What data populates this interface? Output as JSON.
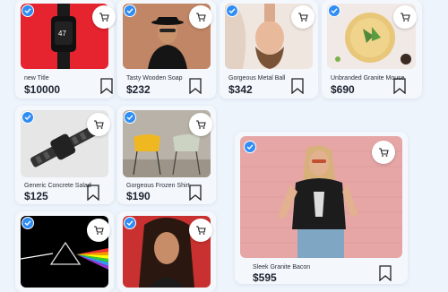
{
  "products": [
    {
      "title": "new Title",
      "price": "$10000",
      "image": "smartwatch-red"
    },
    {
      "title": "Tasty Wooden Soap",
      "price": "$232",
      "image": "man-hat-portrait"
    },
    {
      "title": "Gorgeous Metal Ball",
      "price": "$342",
      "image": "woman-portrait-upside"
    },
    {
      "title": "Unbranded Granite Mouse",
      "price": "$690",
      "image": "food-bowl"
    },
    {
      "title": "Generic Concrete Salad",
      "price": "$125",
      "image": "metal-watch"
    },
    {
      "title": "Gorgeous Frozen Shirt",
      "price": "$190",
      "image": "chairs"
    },
    {
      "title": "Sleek Granite Bacon",
      "price": "$595",
      "image": "woman-tshirt-pink-wall"
    },
    {
      "title": "",
      "price": "",
      "image": "prism-album"
    },
    {
      "title": "",
      "price": "",
      "image": "woman-red-background"
    }
  ],
  "icons": {
    "cart": "cart-icon",
    "verified": "verified-check-icon",
    "bookmark": "bookmark-icon"
  },
  "colors": {
    "accent": "#2f8df5",
    "background": "#eef4fb"
  }
}
